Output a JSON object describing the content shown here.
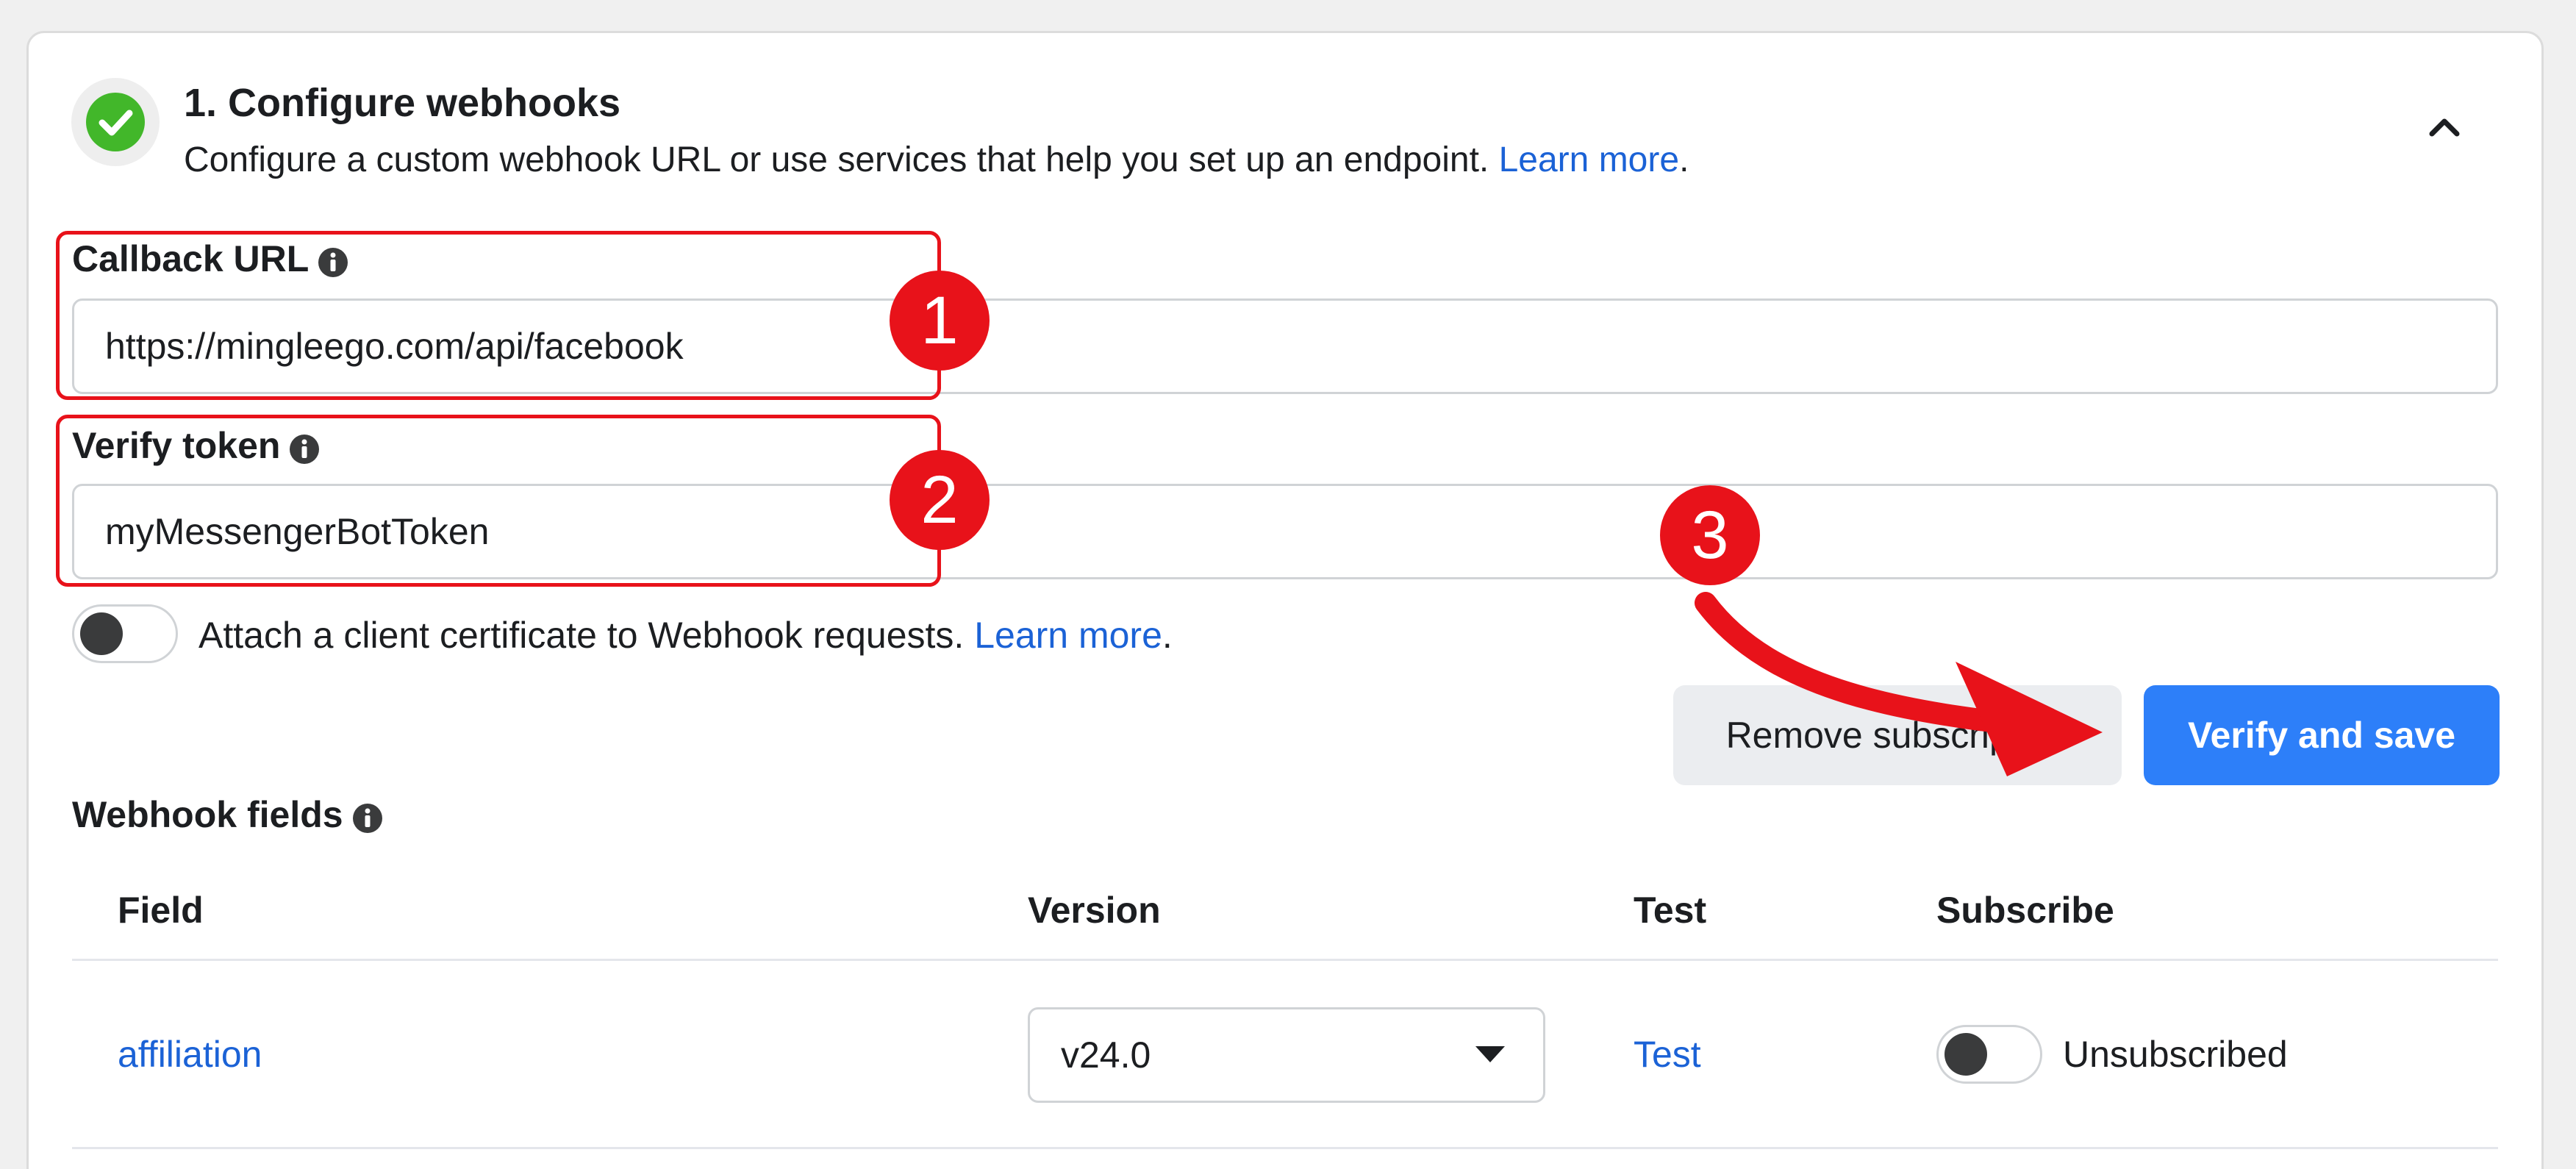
{
  "section": {
    "title": "1. Configure webhooks",
    "description": "Configure a custom webhook URL or use services that help you set up an endpoint.",
    "learn_more": "Learn more",
    "period": "."
  },
  "callback_url": {
    "label": "Callback URL",
    "value": "https://mingleego.com/api/facebook"
  },
  "verify_token": {
    "label": "Verify token",
    "value": "myMessengerBotToken"
  },
  "client_cert": {
    "label": "Attach a client certificate to Webhook requests.",
    "learn_more": "Learn more",
    "period": "."
  },
  "buttons": {
    "remove": "Remove subscription",
    "verify": "Verify and save"
  },
  "webhook_fields": {
    "label": "Webhook fields",
    "headers": {
      "field": "Field",
      "version": "Version",
      "test": "Test",
      "subscribe": "Subscribe"
    },
    "rows": [
      {
        "field": "affiliation",
        "version": "v24.0",
        "test": "Test",
        "status": "Unsubscribed"
      }
    ]
  },
  "annotations": {
    "badge_1": "1",
    "badge_2": "2",
    "badge_3": "3"
  },
  "colors": {
    "link": "#1b62d6",
    "primary_button": "#2d7ff9",
    "annotation_red": "#e8121a",
    "success_green": "#42b72a"
  },
  "icons": {
    "status": "check-circle-icon",
    "collapse": "chevron-up-icon",
    "info": "info-icon",
    "select_caret": "caret-down-icon"
  }
}
